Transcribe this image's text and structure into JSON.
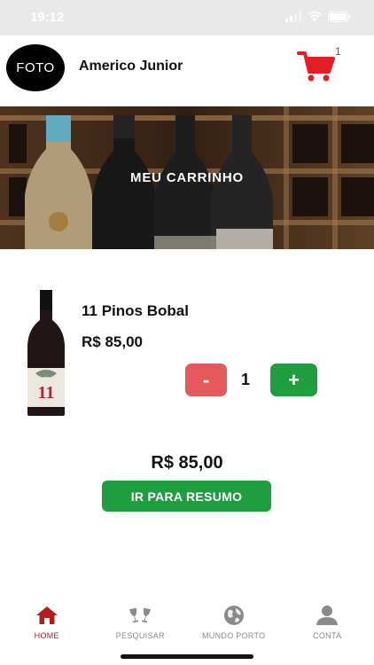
{
  "status_bar": {
    "time": "19:12",
    "icons": [
      "signal-icon",
      "wifi-icon",
      "battery-icon"
    ]
  },
  "header": {
    "avatar_text": "FOTO",
    "user_name": "Americo Junior",
    "cart_icon": "cart-icon",
    "cart_count": "1"
  },
  "banner": {
    "title": "MEU CARRINHO"
  },
  "cart_item": {
    "name": "11 Pinos Bobal",
    "price": "R$ 85,00",
    "minus_label": "-",
    "quantity": "1",
    "plus_label": "+",
    "bottle_label": "11"
  },
  "summary": {
    "total": "R$ 85,00",
    "button_label": "IR PARA RESUMO"
  },
  "tabs": [
    {
      "label": "HOME",
      "icon": "home-icon",
      "active": true
    },
    {
      "label": "PESQUISAR",
      "icon": "wine-glasses-icon",
      "active": false
    },
    {
      "label": "MUNDO PORTO",
      "icon": "globe-icon",
      "active": false
    },
    {
      "label": "CONTA",
      "icon": "user-icon",
      "active": false
    }
  ],
  "colors": {
    "accent_red": "#e51c23",
    "minus_red": "#e5585b",
    "action_green": "#1e9e3f",
    "active_tab": "#b71c1c",
    "inactive_tab": "#8a8a8a"
  }
}
